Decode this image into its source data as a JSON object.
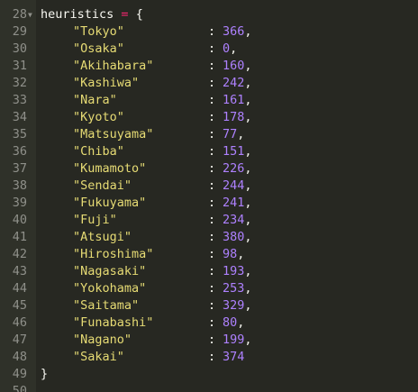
{
  "editor": {
    "first_line": 28,
    "header": {
      "name": "heuristics",
      "op": "=",
      "brace": "{"
    },
    "entries": [
      {
        "key": "\"Tokyo\"",
        "colon": ":",
        "value": "366",
        "sep": ","
      },
      {
        "key": "\"Osaka\"",
        "colon": ":",
        "value": "0",
        "sep": ","
      },
      {
        "key": "\"Akihabara\"",
        "colon": ":",
        "value": "160",
        "sep": ","
      },
      {
        "key": "\"Kashiwa\"",
        "colon": ":",
        "value": "242",
        "sep": ","
      },
      {
        "key": "\"Nara\"",
        "colon": ":",
        "value": "161",
        "sep": ","
      },
      {
        "key": "\"Kyoto\"",
        "colon": ":",
        "value": "178",
        "sep": ","
      },
      {
        "key": "\"Matsuyama\"",
        "colon": ":",
        "value": "77",
        "sep": ","
      },
      {
        "key": "\"Chiba\"",
        "colon": ":",
        "value": "151",
        "sep": ","
      },
      {
        "key": "\"Kumamoto\"",
        "colon": ":",
        "value": "226",
        "sep": ","
      },
      {
        "key": "\"Sendai\"",
        "colon": ":",
        "value": "244",
        "sep": ","
      },
      {
        "key": "\"Fukuyama\"",
        "colon": ":",
        "value": "241",
        "sep": ","
      },
      {
        "key": "\"Fuji\"",
        "colon": ":",
        "value": "234",
        "sep": ","
      },
      {
        "key": "\"Atsugi\"",
        "colon": ":",
        "value": "380",
        "sep": ","
      },
      {
        "key": "\"Hiroshima\"",
        "colon": ":",
        "value": "98",
        "sep": ","
      },
      {
        "key": "\"Nagasaki\"",
        "colon": ":",
        "value": "193",
        "sep": ","
      },
      {
        "key": "\"Yokohama\"",
        "colon": ":",
        "value": "253",
        "sep": ","
      },
      {
        "key": "\"Saitama\"",
        "colon": ":",
        "value": "329",
        "sep": ","
      },
      {
        "key": "\"Funabashi\"",
        "colon": ":",
        "value": "80",
        "sep": ","
      },
      {
        "key": "\"Nagano\"",
        "colon": ":",
        "value": "199",
        "sep": ","
      },
      {
        "key": "\"Sakai\"",
        "colon": ":",
        "value": "374",
        "sep": ""
      }
    ],
    "closing": "}",
    "line_numbers": [
      "28",
      "29",
      "30",
      "31",
      "32",
      "33",
      "34",
      "35",
      "36",
      "37",
      "38",
      "39",
      "40",
      "41",
      "42",
      "43",
      "44",
      "45",
      "46",
      "47",
      "48",
      "49",
      "50"
    ],
    "colors": {
      "background": "#272822",
      "gutter": "#2f3129",
      "line_number": "#8f908a",
      "string": "#e6db74",
      "number": "#ae81ff",
      "operator": "#f92672",
      "text": "#f8f8f2"
    },
    "fold_icon": "fold-arrow-icon"
  }
}
